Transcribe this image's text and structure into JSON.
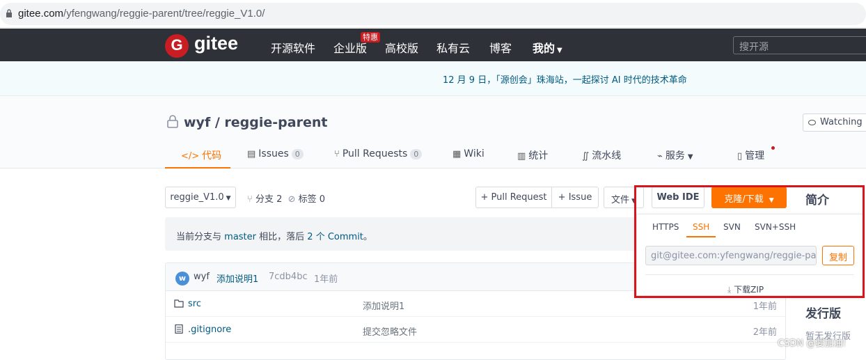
{
  "url": {
    "host": "gitee.com",
    "path": "/yfengwang/reggie-parent/tree/reggie_V1.0/"
  },
  "nav": {
    "logo_text": "gitee",
    "items": [
      "开源软件",
      "企业版",
      "高校版",
      "私有云",
      "博客",
      "我的"
    ],
    "badge": "特惠",
    "search_placeholder": "搜开源"
  },
  "banner": "12 月 9 日，「源创会」珠海站，一起探讨 AI 时代的技术革命",
  "repo": {
    "owner": "wyf",
    "name": "reggie-parent",
    "sep": "/",
    "watch": "Watching"
  },
  "tabs": [
    {
      "label": "代码",
      "icon": "code-icon"
    },
    {
      "label": "Issues",
      "count": "0"
    },
    {
      "label": "Pull Requests",
      "count": "0"
    },
    {
      "label": "Wiki"
    },
    {
      "label": "统计"
    },
    {
      "label": "流水线"
    },
    {
      "label": "服务"
    },
    {
      "label": "管理"
    }
  ],
  "toolbar": {
    "branch": "reggie_V1.0",
    "branches": "分支 2",
    "tags": "标签 0",
    "pr": "+ Pull Request",
    "issue": "+ Issue",
    "file": "文件",
    "webide": "Web IDE",
    "clone": "克隆/下载"
  },
  "compare": {
    "prefix": "当前分支与",
    "branch": "master",
    "mid": "相比，落后",
    "count": "2 个 Commit",
    "suffix": "。"
  },
  "commit": {
    "avatar": "w",
    "author": "wyf",
    "message": "添加说明1",
    "hash": "7cdb4bc",
    "time": "1年前"
  },
  "files": [
    {
      "name": "src",
      "type": "folder",
      "msg": "添加说明1",
      "time": "1年前"
    },
    {
      "name": ".gitignore",
      "type": "file",
      "msg": "提交忽略文件",
      "time": "2年前"
    }
  ],
  "clone_panel": {
    "protocols": [
      "HTTPS",
      "SSH",
      "SVN",
      "SVN+SSH"
    ],
    "active": "SSH",
    "url": "git@gitee.com:yfengwang/reggie-parent.git",
    "copy": "复制",
    "download": "下载ZIP"
  },
  "side": {
    "intro": "简介",
    "release": "发行版",
    "release_empty": "暂无发行版"
  },
  "watermark": "CSDN @要加油!",
  "colors": {
    "accent": "#fe7300",
    "brand": "#c71d23",
    "nav_bg": "#2e3137",
    "highlight_box": "#d9141b"
  }
}
